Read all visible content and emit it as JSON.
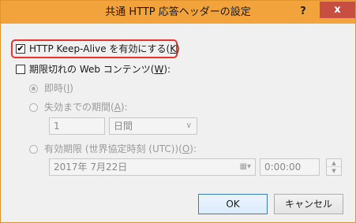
{
  "window": {
    "title": "共通 HTTP 応答ヘッダーの設定",
    "help_label": "?",
    "close_label": "x"
  },
  "keep_alive": {
    "checked": true,
    "label_prefix": "HTTP Keep-Alive を有効にする(",
    "accel": "K",
    "label_suffix": ")"
  },
  "expire_content": {
    "checked": false,
    "label_prefix": "期限切れの Web コンテンツ(",
    "accel": "W",
    "label_suffix": "):"
  },
  "options": {
    "immediate": {
      "label_prefix": "即時(",
      "accel": "I",
      "label_suffix": ")",
      "selected": true
    },
    "after": {
      "label_prefix": "失効までの期間(",
      "accel": "A",
      "label_suffix": "):",
      "selected": false,
      "value": "1",
      "unit": "日間",
      "unit_arrow": "∨"
    },
    "expire_on": {
      "label_prefix": "有効期限 (世界協定時刻 (UTC))(",
      "accel": "O",
      "label_suffix": "):",
      "selected": false,
      "date": "2017年  7月22日",
      "date_icon": "calendar-dropdown-icon",
      "time": "0:00:00"
    }
  },
  "buttons": {
    "ok": "OK",
    "cancel": "キャンセル"
  },
  "colors": {
    "title_bar": "#f3a33b",
    "close_button": "#c74f41",
    "highlight": "#e8332e"
  }
}
